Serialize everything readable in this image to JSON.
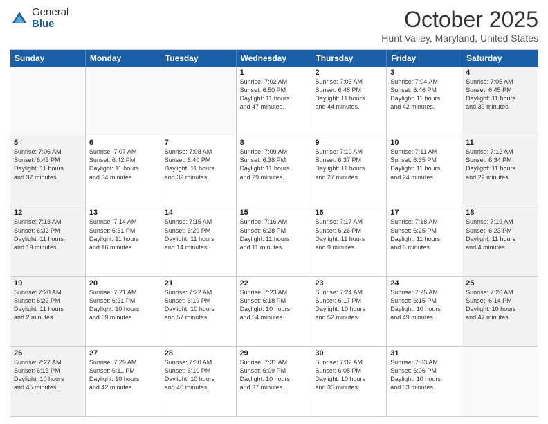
{
  "header": {
    "logo_general": "General",
    "logo_blue": "Blue",
    "title": "October 2025",
    "location": "Hunt Valley, Maryland, United States"
  },
  "days_of_week": [
    "Sunday",
    "Monday",
    "Tuesday",
    "Wednesday",
    "Thursday",
    "Friday",
    "Saturday"
  ],
  "rows": [
    {
      "cells": [
        {
          "day": "",
          "info": "",
          "empty": true
        },
        {
          "day": "",
          "info": "",
          "empty": true
        },
        {
          "day": "",
          "info": "",
          "empty": true
        },
        {
          "day": "1",
          "info": "Sunrise: 7:02 AM\nSunset: 6:50 PM\nDaylight: 11 hours\nand 47 minutes.",
          "empty": false
        },
        {
          "day": "2",
          "info": "Sunrise: 7:03 AM\nSunset: 6:48 PM\nDaylight: 11 hours\nand 44 minutes.",
          "empty": false
        },
        {
          "day": "3",
          "info": "Sunrise: 7:04 AM\nSunset: 6:46 PM\nDaylight: 11 hours\nand 42 minutes.",
          "empty": false
        },
        {
          "day": "4",
          "info": "Sunrise: 7:05 AM\nSunset: 6:45 PM\nDaylight: 11 hours\nand 39 minutes.",
          "empty": false,
          "shaded": true
        }
      ]
    },
    {
      "cells": [
        {
          "day": "5",
          "info": "Sunrise: 7:06 AM\nSunset: 6:43 PM\nDaylight: 11 hours\nand 37 minutes.",
          "empty": false,
          "shaded": true
        },
        {
          "day": "6",
          "info": "Sunrise: 7:07 AM\nSunset: 6:42 PM\nDaylight: 11 hours\nand 34 minutes.",
          "empty": false
        },
        {
          "day": "7",
          "info": "Sunrise: 7:08 AM\nSunset: 6:40 PM\nDaylight: 11 hours\nand 32 minutes.",
          "empty": false
        },
        {
          "day": "8",
          "info": "Sunrise: 7:09 AM\nSunset: 6:38 PM\nDaylight: 11 hours\nand 29 minutes.",
          "empty": false
        },
        {
          "day": "9",
          "info": "Sunrise: 7:10 AM\nSunset: 6:37 PM\nDaylight: 11 hours\nand 27 minutes.",
          "empty": false
        },
        {
          "day": "10",
          "info": "Sunrise: 7:11 AM\nSunset: 6:35 PM\nDaylight: 11 hours\nand 24 minutes.",
          "empty": false
        },
        {
          "day": "11",
          "info": "Sunrise: 7:12 AM\nSunset: 6:34 PM\nDaylight: 11 hours\nand 22 minutes.",
          "empty": false,
          "shaded": true
        }
      ]
    },
    {
      "cells": [
        {
          "day": "12",
          "info": "Sunrise: 7:13 AM\nSunset: 6:32 PM\nDaylight: 11 hours\nand 19 minutes.",
          "empty": false,
          "shaded": true
        },
        {
          "day": "13",
          "info": "Sunrise: 7:14 AM\nSunset: 6:31 PM\nDaylight: 11 hours\nand 16 minutes.",
          "empty": false
        },
        {
          "day": "14",
          "info": "Sunrise: 7:15 AM\nSunset: 6:29 PM\nDaylight: 11 hours\nand 14 minutes.",
          "empty": false
        },
        {
          "day": "15",
          "info": "Sunrise: 7:16 AM\nSunset: 6:28 PM\nDaylight: 11 hours\nand 11 minutes.",
          "empty": false
        },
        {
          "day": "16",
          "info": "Sunrise: 7:17 AM\nSunset: 6:26 PM\nDaylight: 11 hours\nand 9 minutes.",
          "empty": false
        },
        {
          "day": "17",
          "info": "Sunrise: 7:18 AM\nSunset: 6:25 PM\nDaylight: 11 hours\nand 6 minutes.",
          "empty": false
        },
        {
          "day": "18",
          "info": "Sunrise: 7:19 AM\nSunset: 6:23 PM\nDaylight: 11 hours\nand 4 minutes.",
          "empty": false,
          "shaded": true
        }
      ]
    },
    {
      "cells": [
        {
          "day": "19",
          "info": "Sunrise: 7:20 AM\nSunset: 6:22 PM\nDaylight: 11 hours\nand 2 minutes.",
          "empty": false,
          "shaded": true
        },
        {
          "day": "20",
          "info": "Sunrise: 7:21 AM\nSunset: 6:21 PM\nDaylight: 10 hours\nand 59 minutes.",
          "empty": false
        },
        {
          "day": "21",
          "info": "Sunrise: 7:22 AM\nSunset: 6:19 PM\nDaylight: 10 hours\nand 57 minutes.",
          "empty": false
        },
        {
          "day": "22",
          "info": "Sunrise: 7:23 AM\nSunset: 6:18 PM\nDaylight: 10 hours\nand 54 minutes.",
          "empty": false
        },
        {
          "day": "23",
          "info": "Sunrise: 7:24 AM\nSunset: 6:17 PM\nDaylight: 10 hours\nand 52 minutes.",
          "empty": false
        },
        {
          "day": "24",
          "info": "Sunrise: 7:25 AM\nSunset: 6:15 PM\nDaylight: 10 hours\nand 49 minutes.",
          "empty": false
        },
        {
          "day": "25",
          "info": "Sunrise: 7:26 AM\nSunset: 6:14 PM\nDaylight: 10 hours\nand 47 minutes.",
          "empty": false,
          "shaded": true
        }
      ]
    },
    {
      "cells": [
        {
          "day": "26",
          "info": "Sunrise: 7:27 AM\nSunset: 6:13 PM\nDaylight: 10 hours\nand 45 minutes.",
          "empty": false,
          "shaded": true
        },
        {
          "day": "27",
          "info": "Sunrise: 7:29 AM\nSunset: 6:11 PM\nDaylight: 10 hours\nand 42 minutes.",
          "empty": false
        },
        {
          "day": "28",
          "info": "Sunrise: 7:30 AM\nSunset: 6:10 PM\nDaylight: 10 hours\nand 40 minutes.",
          "empty": false
        },
        {
          "day": "29",
          "info": "Sunrise: 7:31 AM\nSunset: 6:09 PM\nDaylight: 10 hours\nand 37 minutes.",
          "empty": false
        },
        {
          "day": "30",
          "info": "Sunrise: 7:32 AM\nSunset: 6:08 PM\nDaylight: 10 hours\nand 35 minutes.",
          "empty": false
        },
        {
          "day": "31",
          "info": "Sunrise: 7:33 AM\nSunset: 6:06 PM\nDaylight: 10 hours\nand 33 minutes.",
          "empty": false
        },
        {
          "day": "",
          "info": "",
          "empty": true
        }
      ]
    }
  ]
}
